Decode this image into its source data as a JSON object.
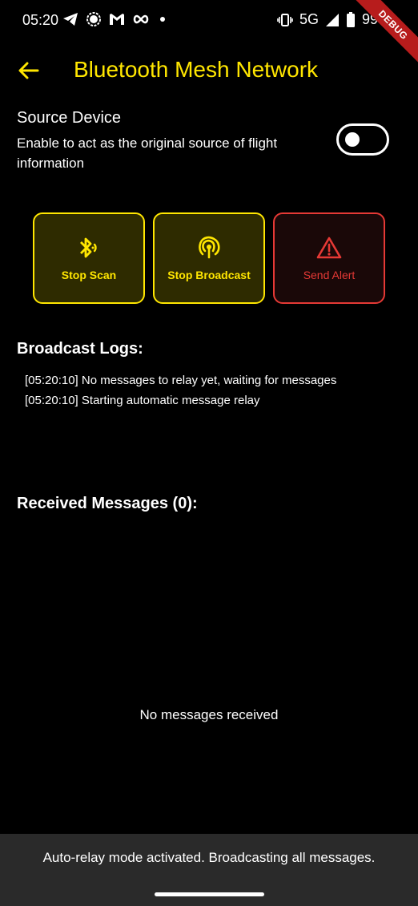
{
  "status_bar": {
    "time": "05:20",
    "network": "5G",
    "battery": "99",
    "left_icons": [
      "telegram-icon",
      "signal-app-icon",
      "gmail-icon",
      "infinity-icon",
      "dot-icon"
    ],
    "right_icons": [
      "vibrate-icon",
      "cell-signal-icon",
      "battery-icon"
    ]
  },
  "debug_banner": "DEBUG",
  "app_bar": {
    "back_icon": "arrow-back-icon",
    "title": "Bluetooth Mesh Network"
  },
  "source_device": {
    "title": "Source Device",
    "description": "Enable to act as the original source of flight information",
    "enabled": false
  },
  "actions": [
    {
      "label": "Stop Scan",
      "icon": "bluetooth-searching-icon",
      "color": "#ffe600"
    },
    {
      "label": "Stop Broadcast",
      "icon": "broadcast-icon",
      "color": "#ffe600"
    },
    {
      "label": "Send Alert",
      "icon": "warning-icon",
      "color": "#e53935"
    }
  ],
  "broadcast_logs": {
    "title": "Broadcast Logs:",
    "entries": [
      "[05:20:10] No messages to relay yet, waiting for messages",
      "[05:20:10] Starting automatic message relay"
    ]
  },
  "received_messages": {
    "title": "Received Messages (0):",
    "empty_text": "No messages received"
  },
  "snackbar": {
    "text": "Auto-relay mode activated. Broadcasting all messages."
  },
  "colors": {
    "accent": "#ffe600",
    "alert": "#e53935",
    "background": "#000000",
    "snackbar": "#2a2a2a"
  }
}
